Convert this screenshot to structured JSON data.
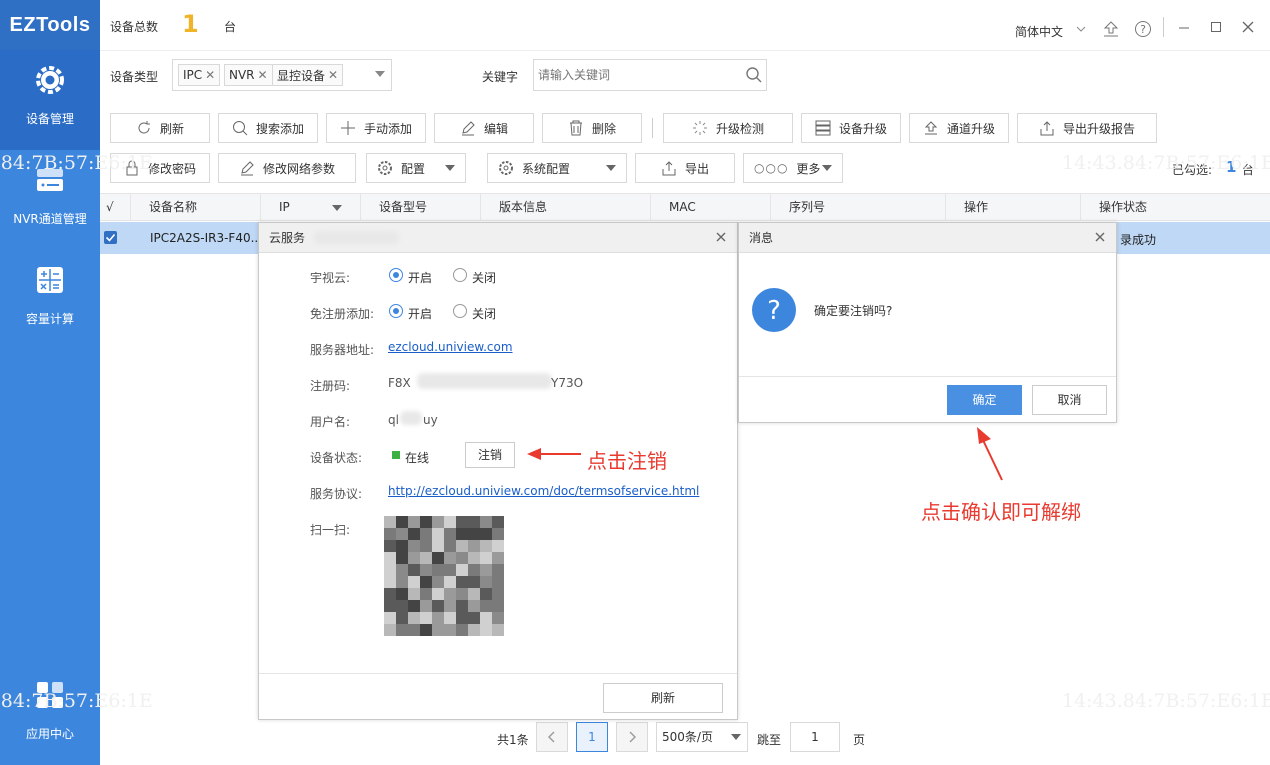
{
  "app": {
    "logo": "EZTools"
  },
  "sidebar": {
    "items": [
      {
        "label": "设备管理",
        "icon": "gear-icon"
      },
      {
        "label": "NVR通道管理",
        "icon": "nvr-icon"
      },
      {
        "label": "容量计算",
        "icon": "calculator-icon"
      },
      {
        "label": "应用中心",
        "icon": "apps-grid-icon"
      }
    ]
  },
  "header": {
    "device_total_label": "设备总数",
    "device_total_count": "1",
    "device_total_unit": "台",
    "language": "简体中文"
  },
  "filter": {
    "type_label": "设备类型",
    "tags": [
      "IPC",
      "NVR",
      "显控设备"
    ],
    "keyword_label": "关键字",
    "keyword_placeholder": "请输入关键词"
  },
  "toolbar1": [
    "刷新",
    "搜索添加",
    "手动添加",
    "编辑",
    "删除",
    "升级检测",
    "设备升级",
    "通道升级",
    "导出升级报告"
  ],
  "toolbar2": [
    "修改密码",
    "修改网络参数",
    "配置",
    "系统配置",
    "导出",
    "更多"
  ],
  "selected": {
    "label": "已勾选:",
    "count": "1",
    "unit": "台"
  },
  "table": {
    "check_header": "√",
    "columns": [
      "设备名称",
      "IP",
      "设备型号",
      "版本信息",
      "MAC",
      "序列号",
      "操作",
      "操作状态"
    ],
    "rows": [
      {
        "name": "IPC2A2S-IR3-F40...",
        "status": "录成功"
      }
    ]
  },
  "watermark": "14:43.84:7B:57:E6:1E",
  "pagination": {
    "total": "共1条",
    "page": "1",
    "per_page": "500条/页",
    "jump_label": "跳至",
    "jump_value": "1",
    "page_unit": "页"
  },
  "cloud_dialog": {
    "title": "云服务",
    "fields": {
      "yunshi_label": "宇视云:",
      "on": "开启",
      "off": "关闭",
      "noreg_label": "免注册添加:",
      "server_label": "服务器地址:",
      "server_value": "ezcloud.uniview.com",
      "regcode_label": "注册码:",
      "regcode_prefix": "F8X",
      "regcode_suffix": "Y73O",
      "user_label": "用户名:",
      "user_prefix": "ql",
      "user_suffix": "uy",
      "status_label": "设备状态:",
      "status_value": "在线",
      "unregister_btn": "注销",
      "protocol_label": "服务协议:",
      "protocol_value": "http://ezcloud.uniview.com/doc/termsofservice.html",
      "scan_label": "扫一扫:"
    },
    "refresh_btn": "刷新"
  },
  "message_dialog": {
    "title": "消息",
    "text": "确定要注销吗?",
    "ok": "确定",
    "cancel": "取消"
  },
  "annotations": {
    "a1": "点击注销",
    "a2": "点击确认即可解绑"
  },
  "colors": {
    "sidebar": "#3d86de",
    "accent": "#4a90e2",
    "annotation": "#e83a2f",
    "online": "#3cb043"
  }
}
